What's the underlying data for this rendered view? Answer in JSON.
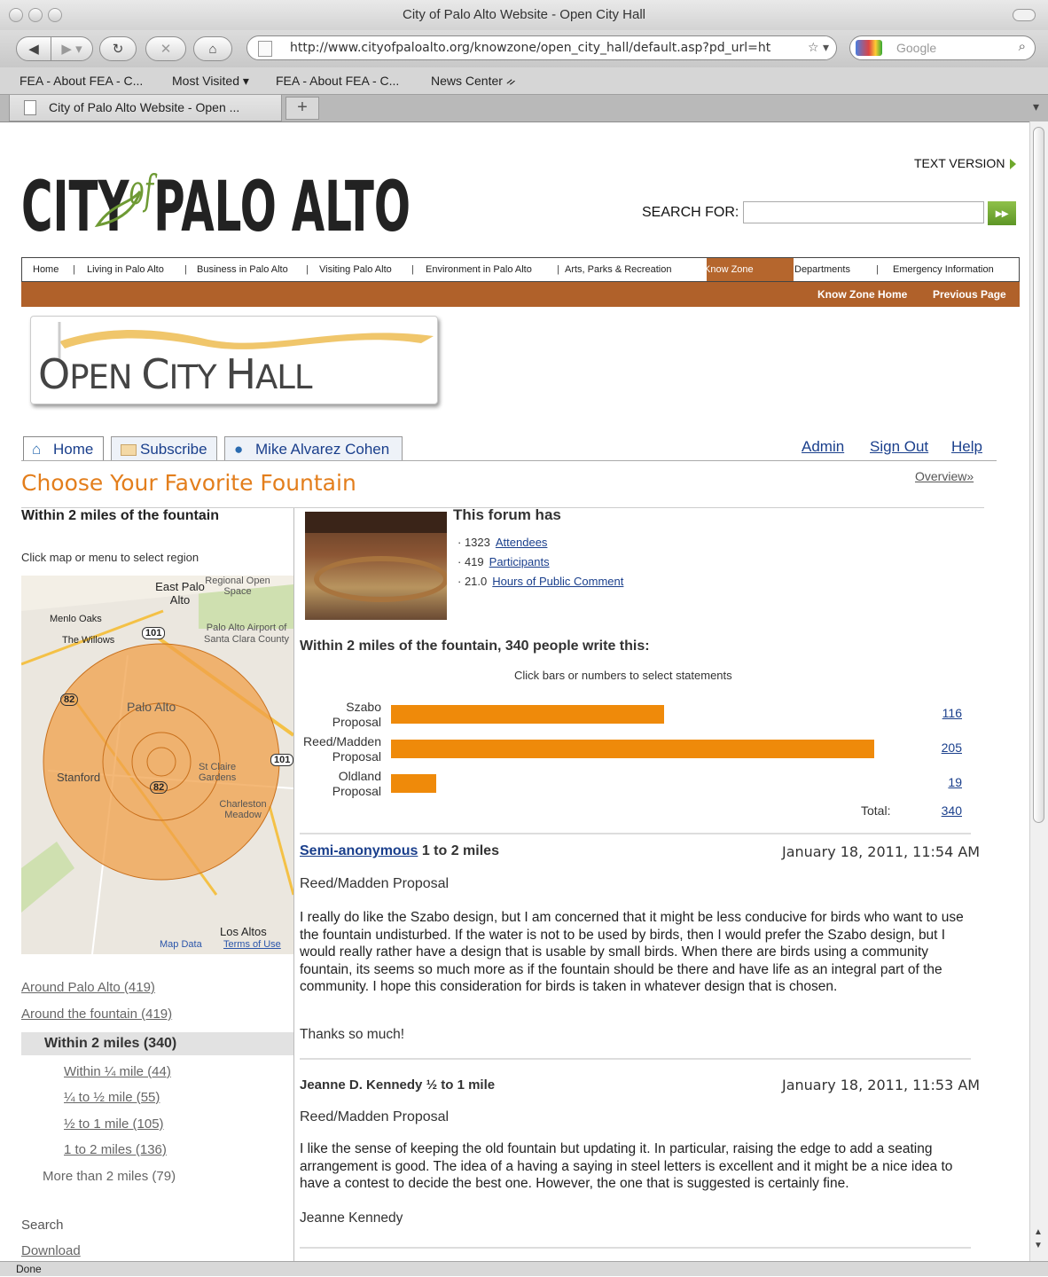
{
  "browser": {
    "window_title": "City of Palo Alto Website - Open City Hall",
    "url": "http://www.cityofpaloalto.org/knowzone/open_city_hall/default.asp?pd_url=ht",
    "search_placeholder": "Google",
    "bookmarks": [
      "FEA - About FEA - C...",
      "Most Visited",
      "FEA - About FEA - C...",
      "News Center"
    ],
    "tab_title": "City of Palo Alto Website - Open ...",
    "new_tab": "+",
    "status": "Done"
  },
  "site": {
    "logo_city": "CITY",
    "logo_of": "of",
    "logo_palo_alto": "PALO ALTO",
    "text_version": "TEXT VERSION",
    "search_label": "SEARCH FOR:",
    "search_go": "▸▸",
    "nav": [
      "Home",
      "Living in Palo Alto",
      "Business in Palo Alto",
      "Visiting Palo Alto",
      "Environment in Palo Alto",
      "Arts, Parks & Recreation",
      "Know Zone",
      "Departments",
      "Emergency Information"
    ],
    "subnav": [
      "Know Zone Home",
      "Previous Page"
    ],
    "och_title": {
      "o": "O",
      "pen": "PEN ",
      "c": "C",
      "ity": "ITY ",
      "h": "H",
      "all": "ALL"
    }
  },
  "forum": {
    "tabs": [
      "Home",
      "Subscribe",
      "Mike Alvarez Cohen"
    ],
    "top_links": [
      "Admin",
      "Sign Out",
      "Help"
    ],
    "heading": "Choose Your Favorite Fountain",
    "overview": "Overview»",
    "left": {
      "title": "Within 2 miles of the fountain",
      "instruction": "Click map or menu to select region",
      "map_labels": [
        "East Palo Alto",
        "Regional Open Space",
        "Menlo Oaks",
        "The Willows",
        "Palo Alto Airport of Santa Clara County",
        "Palo Alto",
        "Stanford",
        "St Claire Gardens",
        "Charleston Meadow",
        "Los Altos",
        "Map Data",
        "Terms of Use",
        "101",
        "82"
      ],
      "regions": [
        "Around Palo Alto (419)",
        "Around the fountain (419)",
        "Within 2 miles (340)",
        "Within ¼ mile (44)",
        "¼ to ½ mile (55)",
        "½ to 1 mile (105)",
        "1 to 2 miles (136)",
        "More than 2 miles (79)"
      ],
      "search": "Search",
      "download": "Download"
    },
    "stats": {
      "title": "This forum has",
      "items": [
        {
          "value": "1323",
          "label": "Attendees"
        },
        {
          "value": "419",
          "label": "Participants"
        },
        {
          "value": "21.0",
          "label": "Hours of Public Comment"
        }
      ]
    },
    "chart_title": "Within 2 miles of the fountain, 340 people write this:",
    "chart_instruction": "Click bars or numbers to select statements",
    "total_label": "Total:",
    "posts": [
      {
        "author": "Semi-anonymous",
        "distance": "1 to 2 miles",
        "date": "January 18, 2011, 11:54 AM",
        "proposal": "Reed/Madden Proposal",
        "body": "I really do like the Szabo design, but I am concerned that it might be less conducive for birds who want to use the fountain undisturbed. If the water is not to be used by birds, then I would prefer the Szabo design, but I would really rather have a design that is usable by small birds. When there are birds using a community fountain, its seems so much more as if the fountain should be there and have life as an integral part of the community. I hope this consideration for birds is taken in whatever design that is chosen.",
        "closing": "Thanks so much!"
      },
      {
        "author": "Jeanne D. Kennedy",
        "distance": "½ to 1 mile",
        "date": "January 18, 2011, 11:53 AM",
        "proposal": "Reed/Madden Proposal",
        "body": "I like the sense of keeping the old fountain but updating it. In particular, raising the edge to add a seating arrangement is good. The idea of a having a saying in steel letters is excellent and it might be a nice idea to have a contest to decide the best one. However, the one that is suggested is certainly fine.",
        "closing": "Jeanne Kennedy"
      }
    ]
  },
  "chart_data": {
    "type": "bar",
    "orientation": "horizontal",
    "categories": [
      "Szabo Proposal",
      "Reed/Madden Proposal",
      "Oldland Proposal"
    ],
    "values": [
      116,
      205,
      19
    ],
    "total": 340,
    "color": "#ef8a0a"
  },
  "colors": {
    "accent_orange": "#e37e1c",
    "nav_brown": "#b0612a",
    "link_blue": "#1a3f8c",
    "logo_green": "#6e9a34"
  }
}
